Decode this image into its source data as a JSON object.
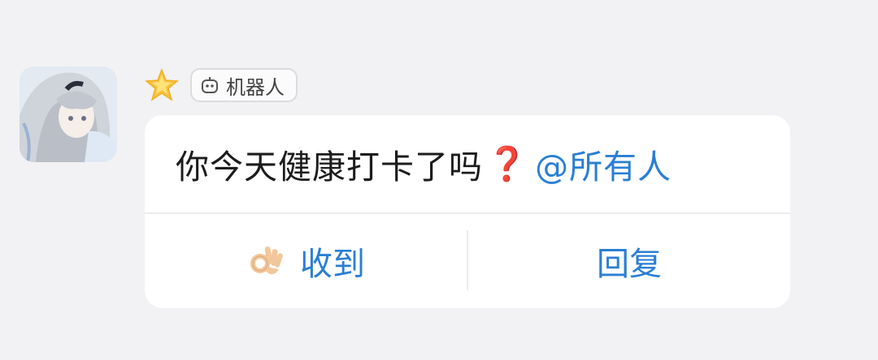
{
  "sender": {
    "badge_icon": "star-icon",
    "tag_icon": "robot-icon",
    "tag_label": "机器人"
  },
  "message": {
    "text": "你今天健康打卡了吗",
    "emoji": "❓",
    "mention": "@所有人"
  },
  "actions": {
    "ack_icon": "ok-hand-icon",
    "ack_label": "收到",
    "reply_label": "回复"
  },
  "colors": {
    "accent": "#2a7fd4",
    "question_mark": "#d9262f",
    "background": "#f2f2f4",
    "card": "#ffffff"
  }
}
